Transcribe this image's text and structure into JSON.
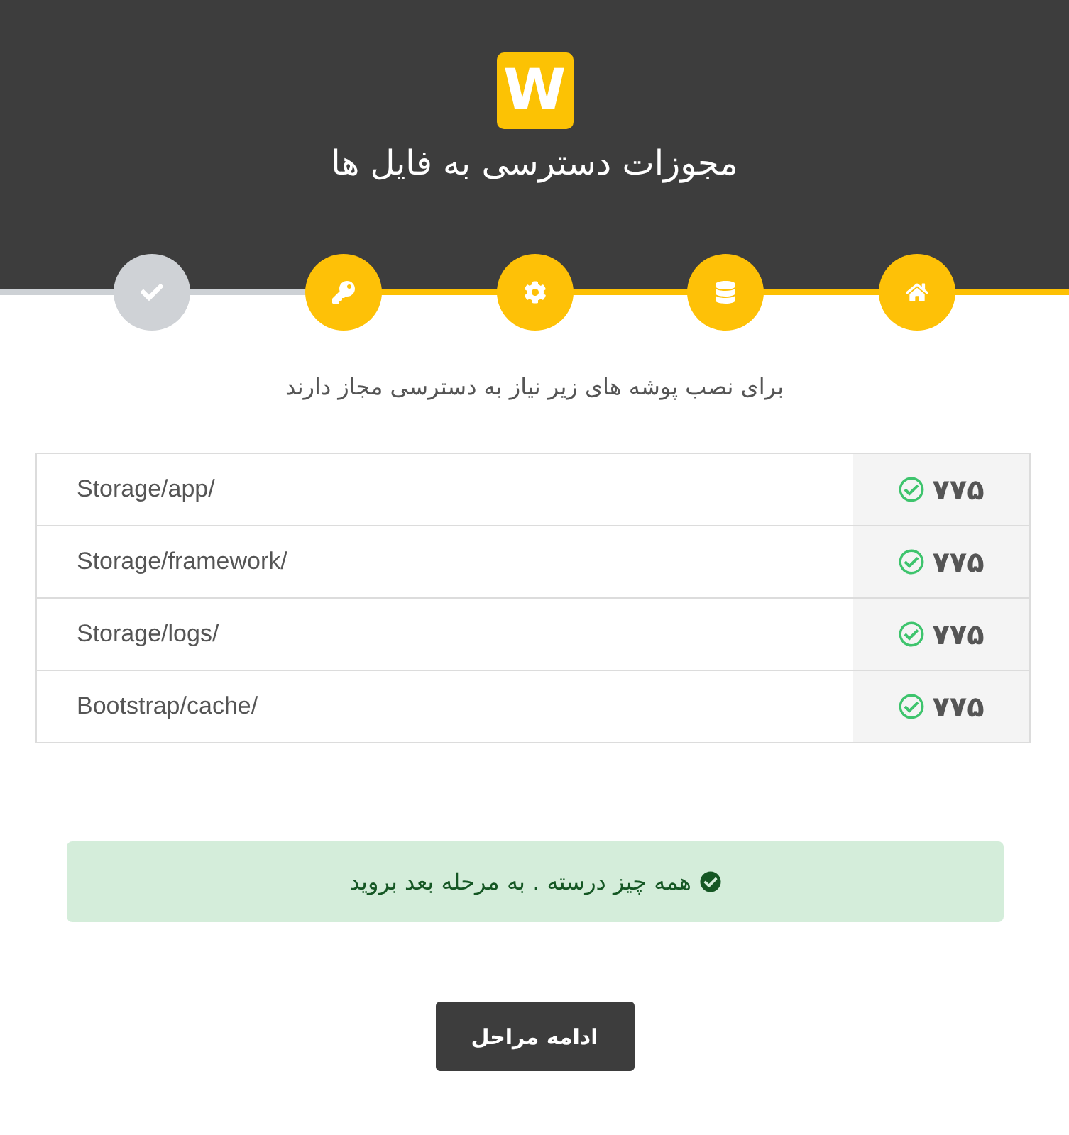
{
  "header": {
    "logo": "W",
    "title": "مجوزات دسترسی به فایل ها"
  },
  "steps": [
    {
      "kind": "home",
      "done": true
    },
    {
      "kind": "database",
      "done": true
    },
    {
      "kind": "settings",
      "done": true
    },
    {
      "kind": "key",
      "done": true
    },
    {
      "kind": "check",
      "done": false
    }
  ],
  "intro": "برای نصب پوشه های زیر نیاز به دسترسی مجاز دارند",
  "permissions": [
    {
      "path": "Storage/app/",
      "mode": "۷۷۵",
      "ok": true
    },
    {
      "path": "Storage/framework/",
      "mode": "۷۷۵",
      "ok": true
    },
    {
      "path": "Storage/logs/",
      "mode": "۷۷۵",
      "ok": true
    },
    {
      "path": "Bootstrap/cache/",
      "mode": "۷۷۵",
      "ok": true
    }
  ],
  "alert": {
    "kind": "success",
    "text": "همه چیز درسته . به مرحله بعد بروید"
  },
  "button": "ادامه مراحل"
}
